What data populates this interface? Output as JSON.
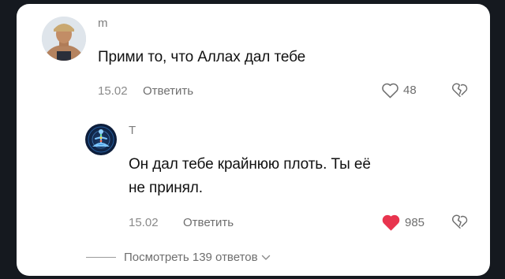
{
  "comment": {
    "username": "m",
    "text": "Прими то, что Аллах дал тебе",
    "date": "15.02",
    "reply_label": "Ответить",
    "likes": "48",
    "liked": false
  },
  "reply": {
    "username": "T",
    "text_line1": "Он дал тебе крайнюю плоть. Ты её",
    "text_line2": "не принял.",
    "date": "15.02",
    "reply_label": "Ответить",
    "likes": "985",
    "liked": true,
    "like_color": "#e8344e"
  },
  "view_replies_label": "Посмотреть 139 ответов",
  "colors": {
    "card_bg": "#ffffff",
    "page_bg": "#15191f",
    "text": "#111111",
    "muted": "#8a8a8a"
  }
}
